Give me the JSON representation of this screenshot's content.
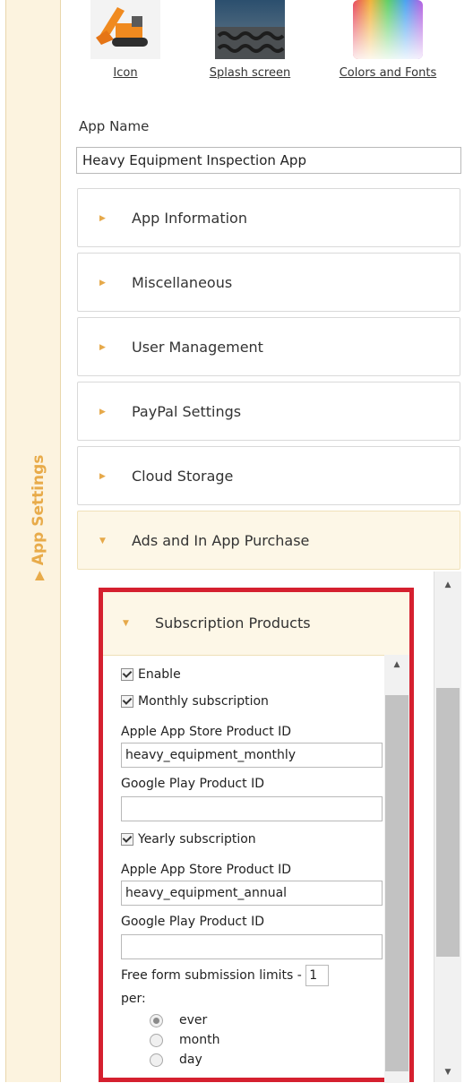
{
  "top_tiles": [
    {
      "label": "Icon",
      "icon": "excavator-icon"
    },
    {
      "label": "Splash screen",
      "icon": "tire-tracks-image"
    },
    {
      "label": "Colors and Fonts",
      "icon": "color-gradient-icon"
    }
  ],
  "side_tab": {
    "label": "App Settings"
  },
  "app_name": {
    "label": "App Name",
    "value": "Heavy Equipment Inspection App"
  },
  "sections": [
    {
      "label": "App Information"
    },
    {
      "label": "Miscellaneous"
    },
    {
      "label": "User Management"
    },
    {
      "label": "PayPal Settings"
    },
    {
      "label": "Cloud Storage"
    },
    {
      "label": "Ads and In App Purchase"
    }
  ],
  "subscription": {
    "header": "Subscription Products",
    "enable_label": "Enable",
    "monthly_label": "Monthly subscription",
    "apple_id_label": "Apple App Store Product ID",
    "monthly_apple_id": "heavy_equipment_monthly",
    "google_id_label": "Google Play Product ID",
    "monthly_google_id": "",
    "yearly_label": "Yearly subscription",
    "yearly_apple_id": "heavy_equipment_annual",
    "yearly_google_id": "",
    "limit_label": "Free form submission limits -",
    "limit_value": "1",
    "per_label": "per:",
    "periods": [
      "ever",
      "month",
      "day"
    ],
    "selected_period": "ever"
  },
  "colors": {
    "highlight": "#d5202f",
    "accent": "#e8ab4a",
    "panel_bg": "#fdf7e7"
  }
}
